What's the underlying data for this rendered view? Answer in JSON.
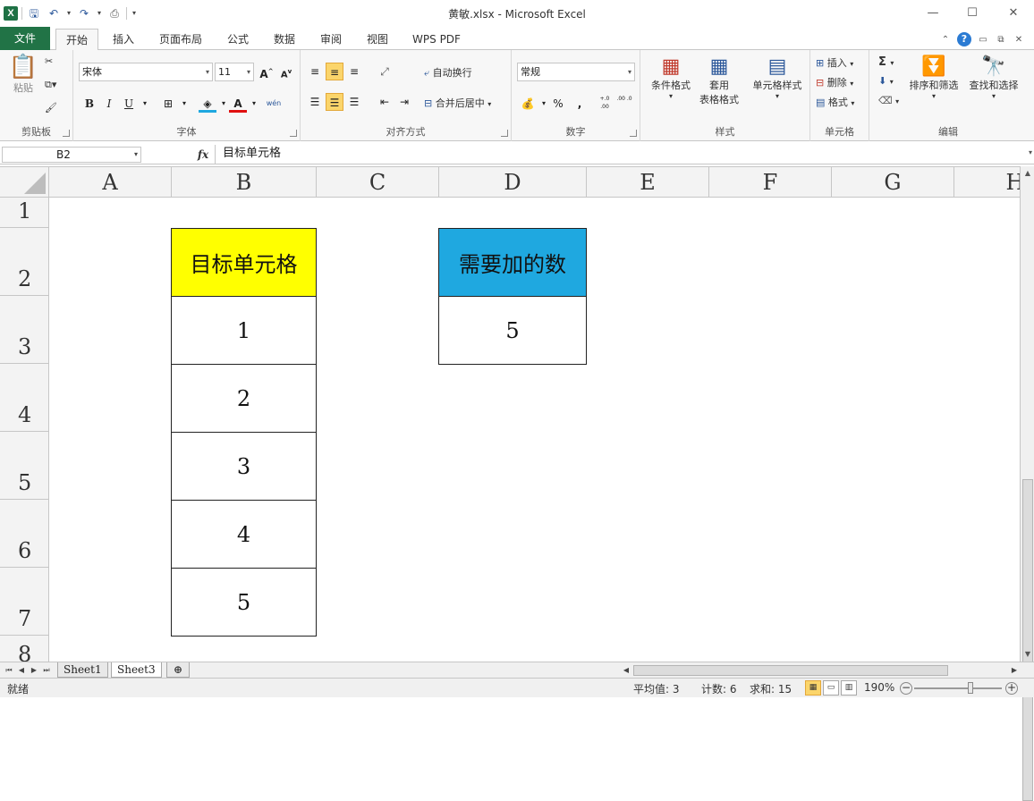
{
  "window": {
    "title": "黄敏.xlsx  -  Microsoft Excel",
    "minimize": "—",
    "restore": "☐",
    "close": "✕"
  },
  "quick_access": {
    "logo": "X",
    "icons": [
      "save-icon",
      "undo-icon",
      "redo-icon",
      "print-preview-icon",
      "customize-icon"
    ]
  },
  "tabs": {
    "file": "文件",
    "items": [
      "开始",
      "插入",
      "页面布局",
      "公式",
      "数据",
      "审阅",
      "视图",
      "WPS PDF"
    ],
    "active": "开始"
  },
  "ribbon": {
    "clipboard": {
      "paste": "粘贴",
      "label": "剪贴板"
    },
    "font": {
      "name": "宋体",
      "size": "11",
      "bold": "B",
      "italic": "I",
      "underline": "U",
      "label": "字体",
      "grow": "A",
      "shrink": "A",
      "phonetic": "wén"
    },
    "alignment": {
      "wrap": "自动换行",
      "merge": "合并后居中",
      "label": "对齐方式"
    },
    "number": {
      "format": "常规",
      "percent": "%",
      "comma": ",",
      "inc_decimal": "+.0 .00",
      "dec_decimal": ".00 .0",
      "label": "数字"
    },
    "styles": {
      "conditional": "条件格式",
      "table_format_1": "套用",
      "table_format_2": "表格格式",
      "cell_styles": "单元格样式",
      "label": "样式"
    },
    "cells": {
      "insert": "插入",
      "delete": "删除",
      "format": "格式",
      "label": "单元格"
    },
    "editing": {
      "sigma": "Σ",
      "sort": "排序和筛选",
      "find": "查找和选择",
      "label": "编辑"
    }
  },
  "formula_bar": {
    "name_box": "B2",
    "fx": "fx",
    "content": "目标单元格"
  },
  "grid": {
    "columns": [
      "A",
      "B",
      "C",
      "D",
      "E",
      "F",
      "G",
      "H"
    ],
    "rows": [
      "1",
      "2",
      "3",
      "4",
      "5",
      "6",
      "7",
      "8"
    ]
  },
  "cells": {
    "B2": "目标单元格",
    "B3": "1",
    "B4": "2",
    "B5": "3",
    "B6": "4",
    "B7": "5",
    "D2": "需要加的数",
    "D3": "5"
  },
  "colors": {
    "target_header_fill": "#ffff00",
    "add_header_fill": "#1fa8e0",
    "file_tab": "#217346"
  },
  "sheets": {
    "tabs": [
      "Sheet1",
      "Sheet3"
    ],
    "active": "Sheet3"
  },
  "status": {
    "ready": "就绪",
    "average": "平均值: 3",
    "count": "计数: 6",
    "sum": "求和: 15",
    "zoom": "190%",
    "zoom_out": "−",
    "zoom_in": "+"
  }
}
